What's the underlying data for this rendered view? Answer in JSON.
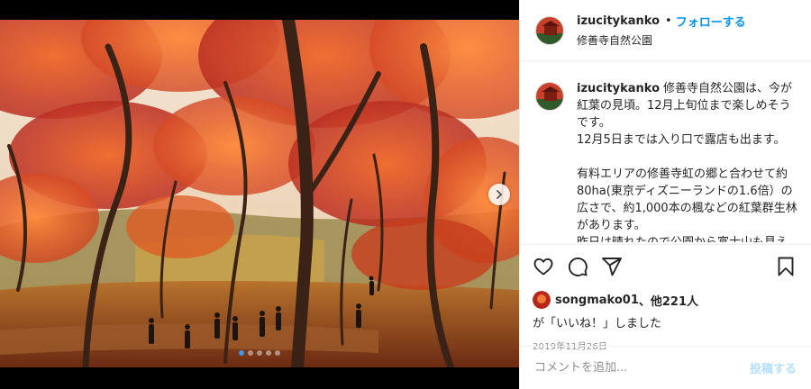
{
  "post": {
    "username": "izucitykanko",
    "separator": "•",
    "follow_label": "フォローする",
    "location": "修善寺自然公園",
    "caption_lines": [
      "修善寺自然公園は、今が紅葉の見頃。12月上旬位まで楽しめそうです。",
      "12月5日までは入り口で露店も出ます。",
      "",
      "有料エリアの修善寺虹の郷と合わせて約80ha(東京ディズニーランドの1.6倍）の広さで、約1,000本の楓などの紅葉群生林があります。",
      "昨日は晴れたので公園から富士山も見え"
    ],
    "likes": {
      "user": "songmako01",
      "others": "、他221人",
      "suffix": "が「いいね！」しました"
    },
    "date": "2019年11月26日",
    "comment": {
      "placeholder": "コメントを追加...",
      "post_label": "投稿する"
    }
  },
  "carousel": {
    "total": 5,
    "active": 1
  },
  "icons": {
    "like": "heart-icon",
    "comment": "comment-icon",
    "share": "paper-plane-icon",
    "save": "bookmark-icon",
    "next": "chevron-right-icon"
  },
  "colors": {
    "accent": "#0095f6",
    "active_dot": "#3897f0",
    "foliage": "#d9451e"
  }
}
